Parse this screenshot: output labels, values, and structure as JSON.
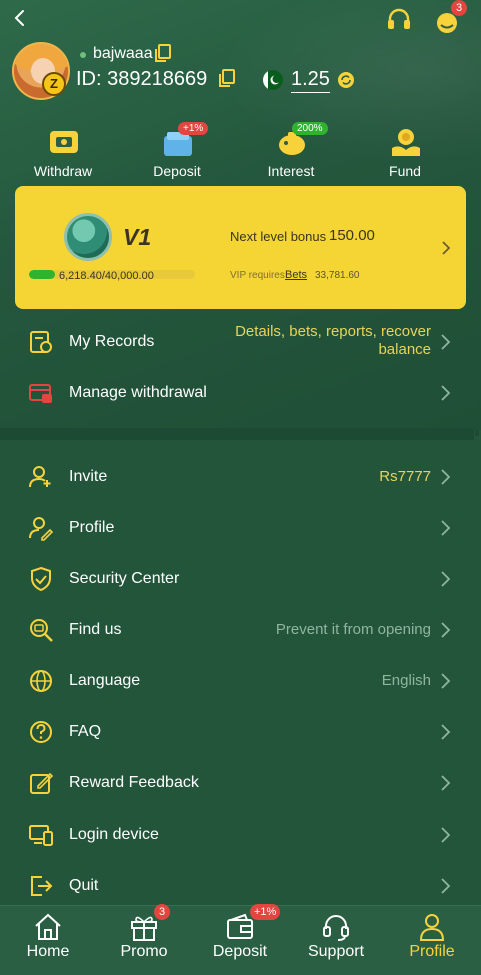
{
  "header": {
    "username": "bajwaaa",
    "id_label": "ID: 389218669",
    "balance": "1.25",
    "vip_mini_badge": "Z",
    "notification_count": "3"
  },
  "quick_actions": [
    {
      "label": "Withdraw",
      "icon": "withdraw-icon",
      "tag": ""
    },
    {
      "label": "Deposit",
      "icon": "deposit-icon",
      "tag": "+1%"
    },
    {
      "label": "Interest",
      "icon": "interest-icon",
      "tag": "200%"
    },
    {
      "label": "Fund",
      "icon": "fund-icon",
      "tag": ""
    }
  ],
  "vip": {
    "level": "V1",
    "next_level_label": "Next level bonus",
    "next_level_value": "150.00",
    "progress_text": "6,218.40/40,000.00",
    "progress_fraction": 0.155,
    "requires_label": "VIP requires",
    "requires_bets_label": "Bets",
    "requires_value": "33,781.60"
  },
  "menu_top": [
    {
      "label": "My Records",
      "value": "Details, bets, reports, recover balance",
      "icon": "records-icon"
    },
    {
      "label": "Manage withdrawal",
      "value": "",
      "icon": "withdrawal-card-icon"
    }
  ],
  "menu_main": [
    {
      "label": "Invite",
      "value": "Rs7777",
      "icon": "invite-icon"
    },
    {
      "label": "Profile",
      "value": "",
      "icon": "profile-edit-icon"
    },
    {
      "label": "Security Center",
      "value": "",
      "icon": "shield-check-icon"
    },
    {
      "label": "Find us",
      "value": "Prevent it from opening",
      "icon": "find-us-icon"
    },
    {
      "label": "Language",
      "value": "English",
      "icon": "globe-icon"
    },
    {
      "label": "FAQ",
      "value": "",
      "icon": "question-icon"
    },
    {
      "label": "Reward Feedback",
      "value": "",
      "icon": "feedback-icon"
    },
    {
      "label": "Login device",
      "value": "",
      "icon": "devices-icon"
    },
    {
      "label": "Quit",
      "value": "",
      "icon": "logout-icon"
    }
  ],
  "bottom_nav": [
    {
      "label": "Home",
      "icon": "home-icon",
      "badge": ""
    },
    {
      "label": "Promo",
      "icon": "gift-icon",
      "badge": "3"
    },
    {
      "label": "Deposit",
      "icon": "wallet-icon",
      "badge": "+1%"
    },
    {
      "label": "Support",
      "icon": "headset-icon",
      "badge": ""
    },
    {
      "label": "Profile",
      "icon": "person-icon",
      "badge": ""
    }
  ],
  "colors": {
    "background": "#23553b",
    "accent_yellow": "#f7d23a",
    "vip_card": "#f5d533",
    "badge_red": "#e3453f",
    "tag_green": "#2fb32f",
    "value_yellow": "#e8d35a",
    "value_muted": "#8fb59f"
  }
}
